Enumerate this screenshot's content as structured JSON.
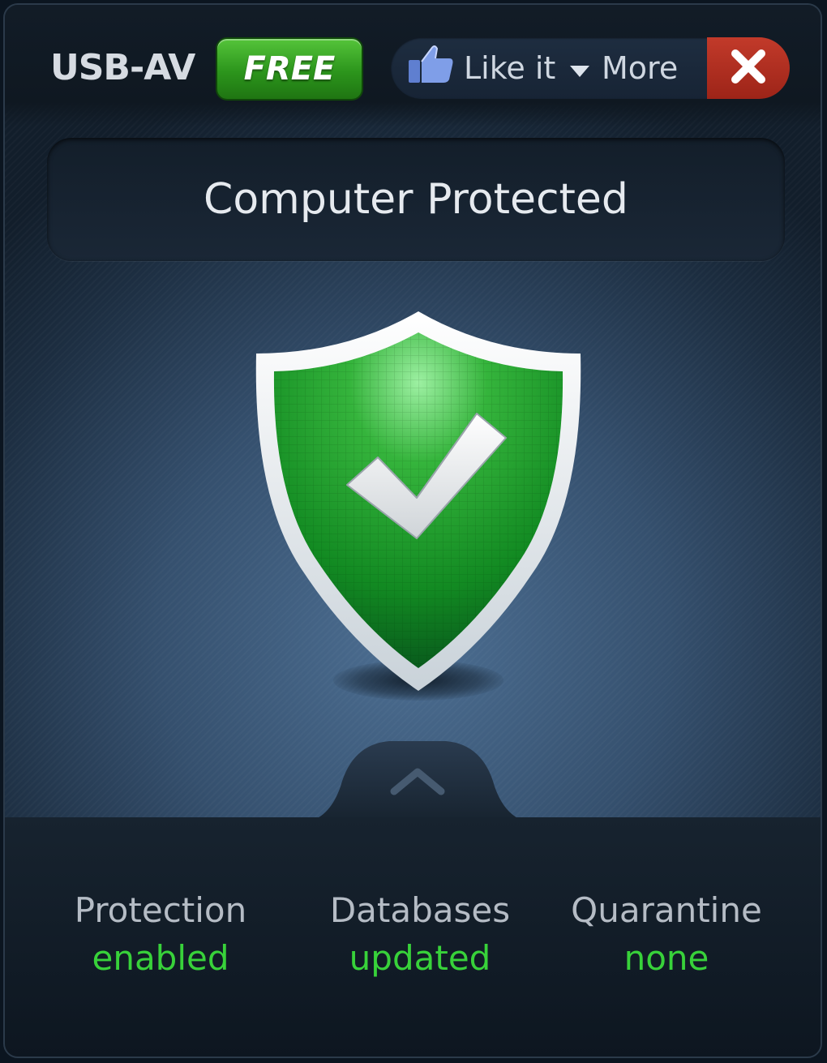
{
  "header": {
    "app_title": "USB-AV",
    "edition_badge": "FREE",
    "like_label": "Like it",
    "more_label": "More"
  },
  "status": {
    "title": "Computer Protected"
  },
  "stats": [
    {
      "label": "Protection",
      "value": "enabled"
    },
    {
      "label": "Databases",
      "value": "updated"
    },
    {
      "label": "Quarantine",
      "value": "none"
    }
  ],
  "colors": {
    "accent_green": "#38d23a",
    "close_red": "#b02e20",
    "badge_green": "#2c951c"
  },
  "icons": [
    "thumbs-up-icon",
    "dropdown-arrow-icon",
    "close-icon",
    "shield-check-icon",
    "chevron-up-icon"
  ]
}
